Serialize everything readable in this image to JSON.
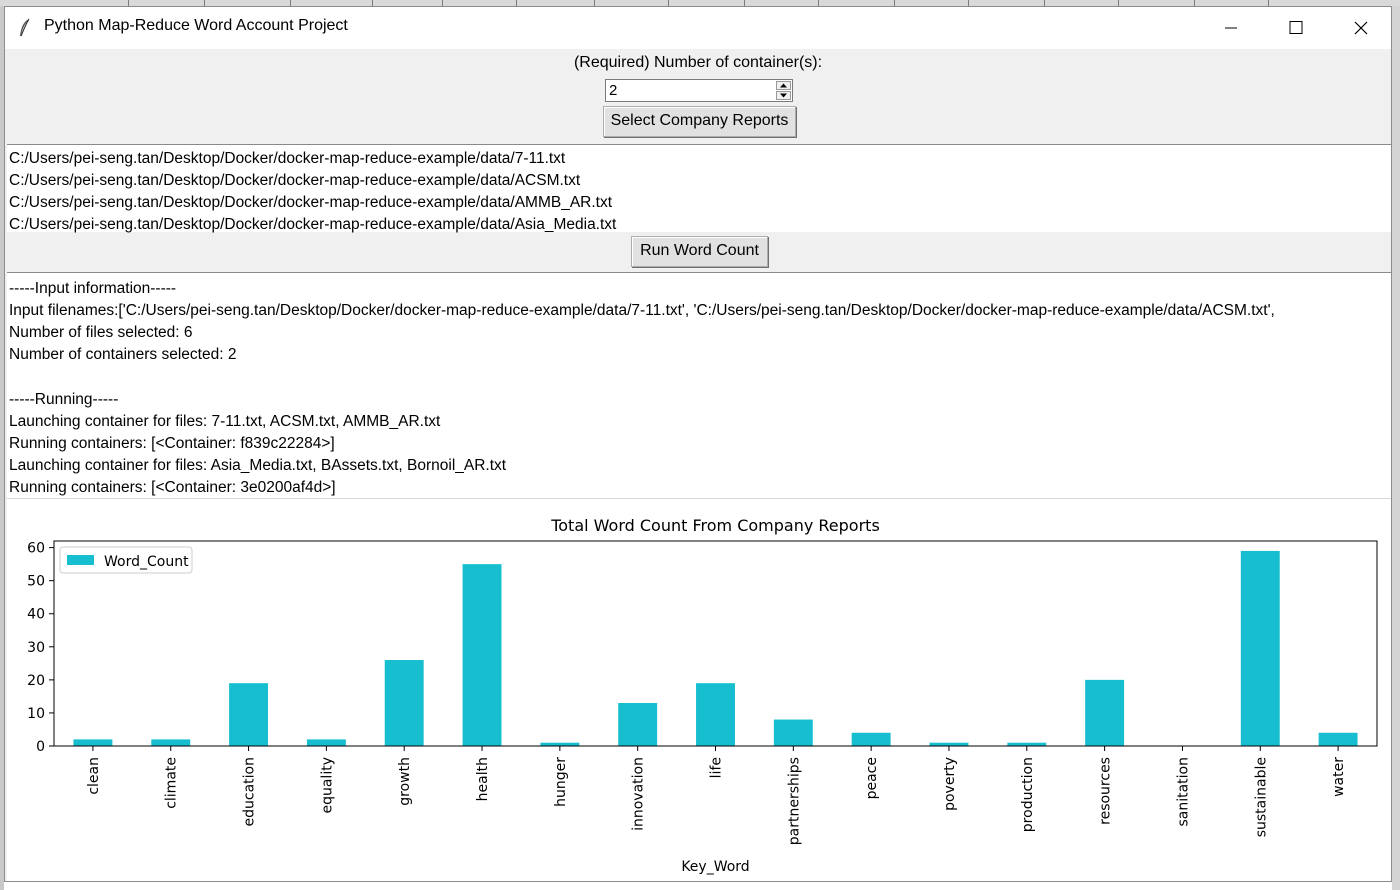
{
  "window": {
    "title": "Python Map-Reduce Word Account Project",
    "icon": "feather-icon"
  },
  "controls": {
    "containers_label": "(Required) Number of container(s):",
    "containers_value": "2",
    "select_button": "Select Company Reports",
    "run_button": "Run Word Count"
  },
  "files": [
    "C:/Users/pei-seng.tan/Desktop/Docker/docker-map-reduce-example/data/7-11.txt",
    "C:/Users/pei-seng.tan/Desktop/Docker/docker-map-reduce-example/data/ACSM.txt",
    "C:/Users/pei-seng.tan/Desktop/Docker/docker-map-reduce-example/data/AMMB_AR.txt",
    "C:/Users/pei-seng.tan/Desktop/Docker/docker-map-reduce-example/data/Asia_Media.txt"
  ],
  "log": [
    "-----Input information-----",
    "Input filenames:['C:/Users/pei-seng.tan/Desktop/Docker/docker-map-reduce-example/data/7-11.txt', 'C:/Users/pei-seng.tan/Desktop/Docker/docker-map-reduce-example/data/ACSM.txt',",
    "Number of files selected: 6",
    "Number of containers selected: 2",
    "",
    "-----Running-----",
    "Launching container for files: 7-11.txt, ACSM.txt, AMMB_AR.txt",
    "Running containers: [<Container: f839c22284>]",
    "Launching container for files: Asia_Media.txt, BAssets.txt, Bornoil_AR.txt",
    "Running containers: [<Container: 3e0200af4d>]"
  ],
  "colors": {
    "bar": "#17becf",
    "window_bg": "#f0f0f0"
  },
  "chart_data": {
    "type": "bar",
    "title": "Total Word Count From Company Reports",
    "xlabel": "Key_Word",
    "ylabel": "",
    "categories": [
      "clean",
      "climate",
      "education",
      "equality",
      "growth",
      "health",
      "hunger",
      "innovation",
      "life",
      "partnerships",
      "peace",
      "poverty",
      "production",
      "resources",
      "sanitation",
      "sustainable",
      "water"
    ],
    "series": [
      {
        "name": "Word_Count",
        "values": [
          2,
          2,
          19,
          2,
          26,
          55,
          1,
          13,
          19,
          8,
          4,
          1,
          1,
          20,
          0,
          59,
          4
        ]
      }
    ],
    "ylim": [
      0,
      62
    ],
    "yticks": [
      0,
      10,
      20,
      30,
      40,
      50,
      60
    ],
    "legend": "top-left",
    "grid": false
  }
}
